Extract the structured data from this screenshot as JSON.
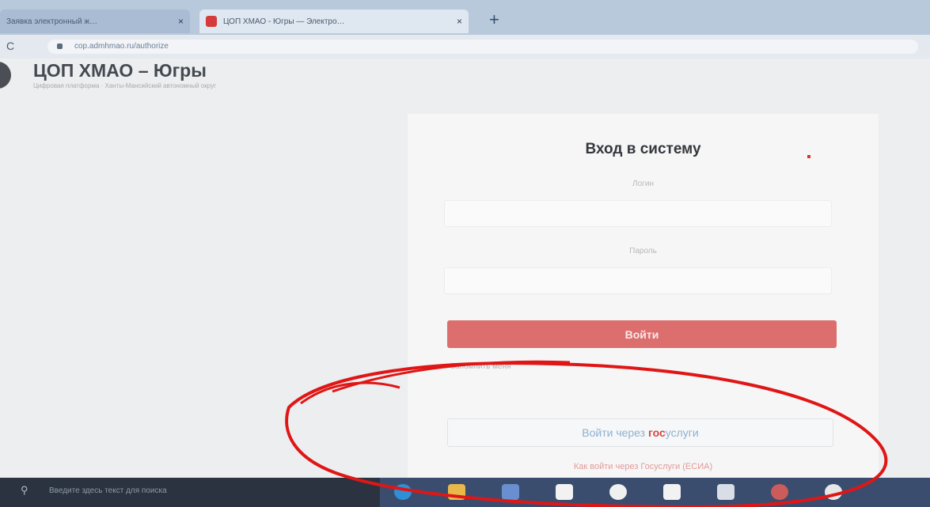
{
  "browser": {
    "tabs": [
      {
        "title": "Заявка электронный ж…",
        "close": "×"
      },
      {
        "title": "ЦОП ХМАО - Югры — Электро…",
        "close": "×"
      }
    ],
    "new_tab": "+",
    "reload": "C",
    "url": "cop.admhmao.ru/authorize"
  },
  "header": {
    "title": "ЦОП ХМАО – Югры",
    "subtitle": "Цифровая платформа · Ханты-Мансийский автономный округ"
  },
  "login": {
    "title": "Вход в систему",
    "login_label": "Логин",
    "password_label": "Пароль",
    "submit": "Войти",
    "remember": "Запомнить меня",
    "gosuslugi_prefix": "Войти через ",
    "gosuslugi_bold": "гос",
    "gosuslugi_rest": "услуги",
    "esia_link": "Как войти через Госуслуги (ЕСИА)"
  },
  "search": {
    "placeholder": "Введите здесь текст для поиска"
  },
  "taskbar": {
    "icons": [
      "edge-icon",
      "file-explorer-icon",
      "store-icon",
      "word-doc-icon",
      "yandex-browser-icon",
      "document-icon",
      "photos-icon",
      "chrome-icon",
      "camera-icon"
    ]
  },
  "colors": {
    "accent": "#dc6e6e",
    "gosuslugi_blue": "#8fb0cf",
    "gosuslugi_red": "#d64545",
    "annotation": "#e01616",
    "taskbar": "#3a4d6e"
  }
}
